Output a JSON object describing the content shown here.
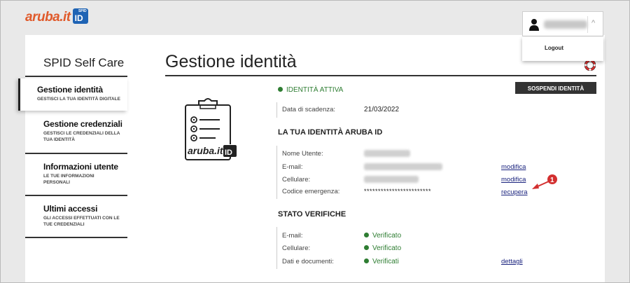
{
  "header": {
    "logo_brand": "aruba.it",
    "logo_badge_small": "SPID",
    "logo_badge_id": "ID",
    "user_chevron": "^",
    "logout_label": "Logout"
  },
  "sidebar": {
    "title": "SPID Self Care",
    "items": [
      {
        "label": "Gestione identità",
        "desc": "GESTISCI LA TUA IDENTITÀ DIGITALE"
      },
      {
        "label": "Gestione credenziali",
        "desc": "GESTISCI LE CREDENZIALI DELLA TUA IDENTITÀ"
      },
      {
        "label": "Informazioni utente",
        "desc": "LE TUE INFORMAZIONI PERSONALI"
      },
      {
        "label": "Ultimi accessi",
        "desc": "GLI ACCESSI EFFETTUATI CON LE TUE CREDENZIALI"
      }
    ]
  },
  "main": {
    "title": "Gestione identità",
    "status": "IDENTITÀ ATTIVA",
    "suspend_button": "SOSPENDI IDENTITÀ",
    "expiry_label": "Data di scadenza:",
    "expiry_value": "21/03/2022",
    "identity_section": "LA TUA IDENTITÀ ARUBA ID",
    "identity_rows": [
      {
        "label": "Nome Utente:",
        "value": ""
      },
      {
        "label": "E-mail:",
        "value": "",
        "action": "modifica"
      },
      {
        "label": "Cellulare:",
        "value": "",
        "action": "modifica"
      },
      {
        "label": "Codice emergenza:",
        "value": "************************",
        "action": "recupera"
      }
    ],
    "verification_section": "STATO VERIFICHE",
    "verification_rows": [
      {
        "label": "E-mail:",
        "value": "Verificato"
      },
      {
        "label": "Cellulare:",
        "value": "Verificato"
      },
      {
        "label": "Dati e documenti:",
        "value": "Verificati",
        "action": "dettagli"
      }
    ],
    "illustration_text": "aruba.it",
    "illustration_badge": "ID",
    "annotation_number": "1"
  },
  "colors": {
    "accent_green": "#2e7d32",
    "brand_orange": "#e05a2b",
    "brand_blue": "#1e63b4",
    "link_color": "#1a237e",
    "annotation_red": "#d32f2f"
  },
  "icons": {
    "user": "user-icon",
    "help": "lifebuoy-icon",
    "illustration": "clipboard-icon"
  }
}
